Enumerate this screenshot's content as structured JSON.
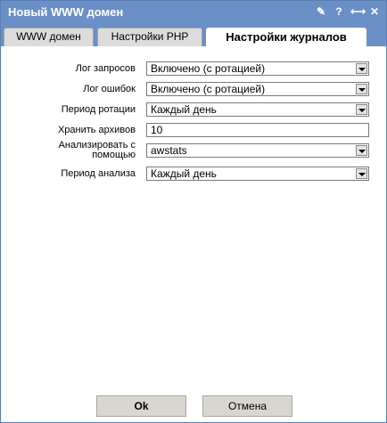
{
  "window": {
    "title": "Новый WWW домен",
    "icons": [
      "pin-icon",
      "help-icon",
      "collapse-icon",
      "close-icon"
    ],
    "icon_glyphs": {
      "pin": "✎",
      "help": "?",
      "collapse": "⟷",
      "close": "✕"
    }
  },
  "tabs": [
    {
      "label": "WWW домен"
    },
    {
      "label": "Настройки PHP"
    },
    {
      "label": "Настройки журналов",
      "active": true
    }
  ],
  "form": {
    "request_log": {
      "label": "Лог запросов",
      "value": "Включено (с ротацией)"
    },
    "error_log": {
      "label": "Лог ошибок",
      "value": "Включено (с ротацией)"
    },
    "rotation_period": {
      "label": "Период ротации",
      "value": "Каждый день"
    },
    "keep_archives": {
      "label": "Хранить архивов",
      "value": "10"
    },
    "analyzer": {
      "label_line1": "Анализировать с",
      "label_line2": "помощью",
      "value": "awstats"
    },
    "analysis_period": {
      "label": "Период анализа",
      "value": "Каждый день"
    }
  },
  "buttons": {
    "ok": "Ok",
    "cancel": "Отмена"
  },
  "colors": {
    "titlebar": "#6b8fc7",
    "button": "#d8d6cf"
  }
}
